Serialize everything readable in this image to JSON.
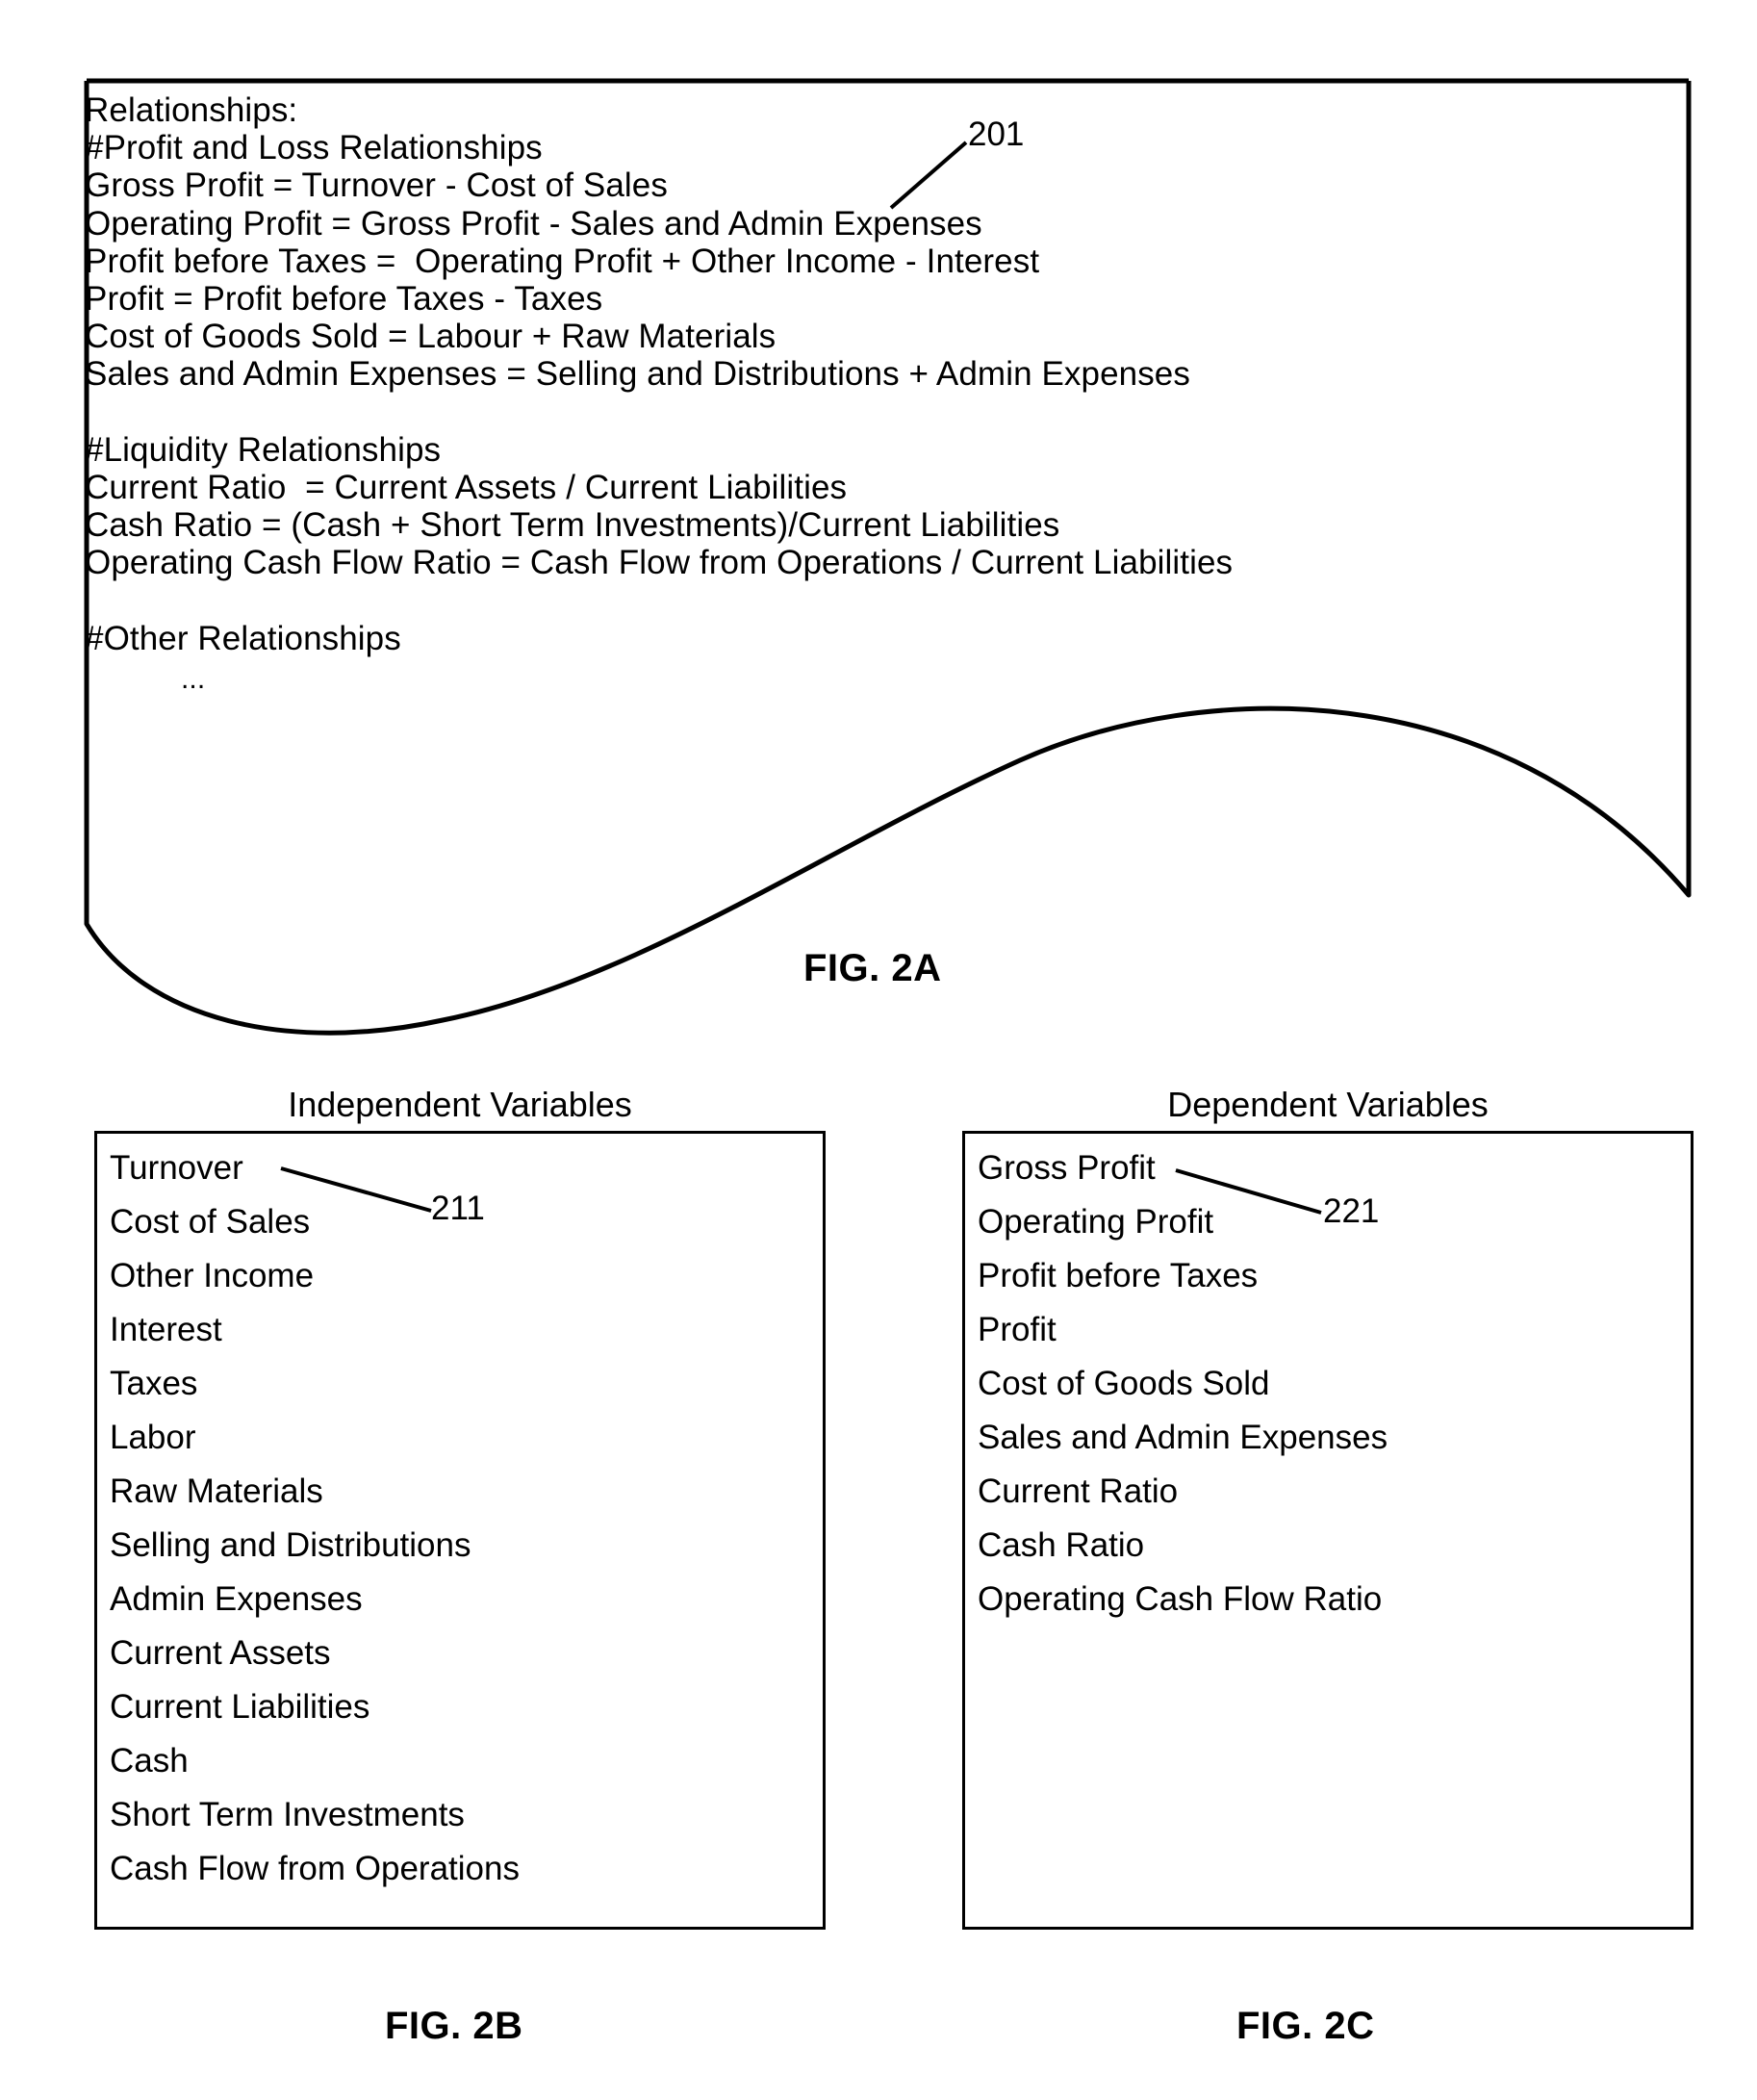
{
  "figures": {
    "fig2a": {
      "caption": "FIG. 2A",
      "callout": "201",
      "lines": [
        "Relationships:",
        "#Profit and Loss Relationships",
        "Gross Profit = Turnover - Cost of Sales",
        "Operating Profit = Gross Profit - Sales and Admin Expenses",
        "Profit before Taxes =  Operating Profit + Other Income - Interest",
        "Profit = Profit before Taxes - Taxes",
        "Cost of Goods Sold = Labour + Raw Materials",
        "Sales and Admin Expenses = Selling and Distributions + Admin Expenses",
        "",
        "#Liquidity Relationships",
        "Current Ratio  = Current Assets / Current Liabilities",
        "Cash Ratio = (Cash + Short Term Investments)/Current Liabilities",
        "Operating Cash Flow Ratio = Cash Flow from Operations / Current Liabilities",
        "",
        "#Other Relationships"
      ],
      "continuation": "..."
    },
    "fig2b": {
      "caption": "FIG. 2B",
      "title": "Independent Variables",
      "callout": "211",
      "items": [
        "Turnover",
        "Cost of Sales",
        "Other Income",
        "Interest",
        "Taxes",
        "Labor",
        "Raw Materials",
        "Selling and Distributions",
        "Admin Expenses",
        "Current Assets",
        "Current Liabilities",
        "Cash",
        "Short Term Investments",
        "Cash Flow from Operations"
      ]
    },
    "fig2c": {
      "caption": "FIG. 2C",
      "title": "Dependent Variables",
      "callout": "221",
      "items": [
        "Gross Profit",
        "Operating Profit",
        "Profit before Taxes",
        "Profit",
        "Cost of Goods Sold",
        "Sales and Admin Expenses",
        "Current Ratio",
        "Cash Ratio",
        "Operating Cash Flow Ratio"
      ]
    }
  },
  "colors": {
    "ink": "#000000",
    "paper": "#ffffff"
  }
}
